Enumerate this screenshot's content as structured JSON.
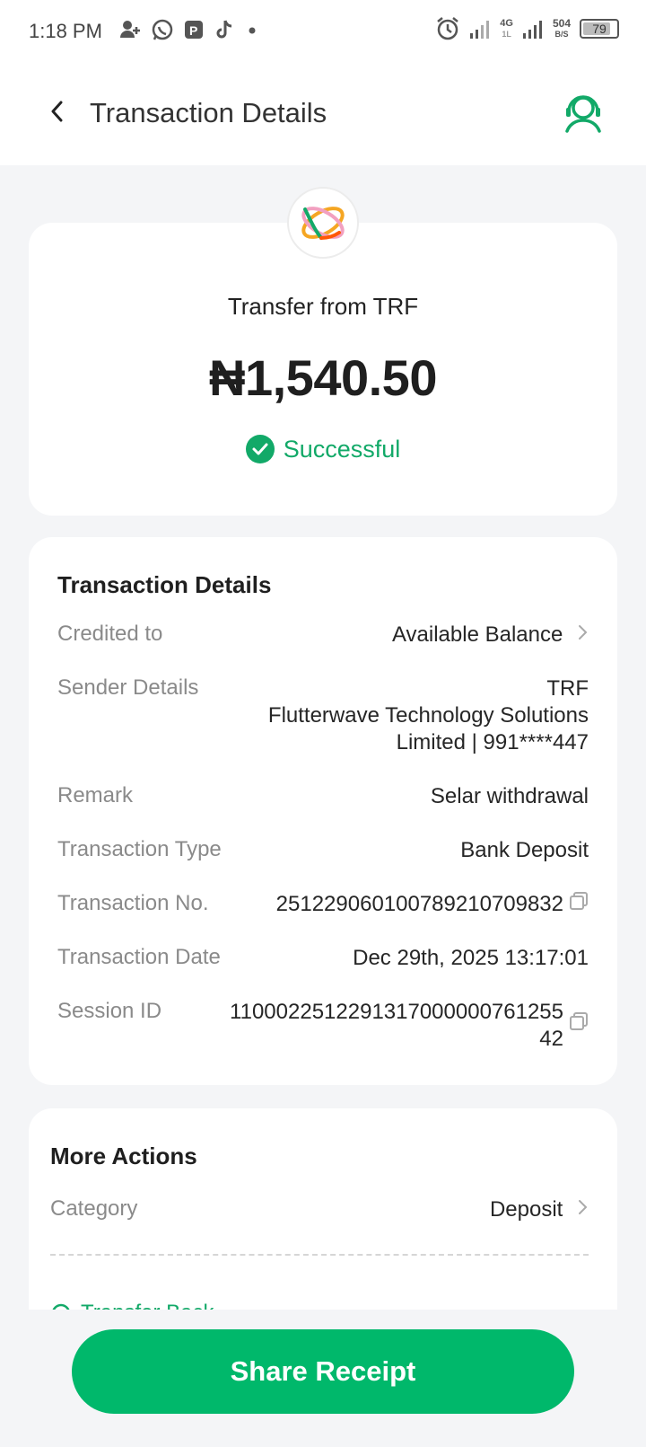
{
  "status_bar": {
    "time": "1:18 PM",
    "network_top": "4G",
    "network_bottom": "1L",
    "speed_value": "504",
    "speed_unit": "B/S",
    "battery": "79"
  },
  "header": {
    "title": "Transaction Details"
  },
  "summary": {
    "title": "Transfer from TRF",
    "amount": "₦1,540.50",
    "status": "Successful"
  },
  "details": {
    "section_title": "Transaction Details",
    "rows": [
      {
        "label": "Credited to",
        "value": "Available Balance"
      },
      {
        "label": "Sender Details",
        "value_line1": "TRF",
        "value_line2": "Flutterwave Technology Solutions",
        "value_line3": "Limited | 991****447"
      },
      {
        "label": "Remark",
        "value": "Selar withdrawal"
      },
      {
        "label": "Transaction Type",
        "value": "Bank Deposit"
      },
      {
        "label": "Transaction No.",
        "value": "251229060100789210709832"
      },
      {
        "label": "Transaction Date",
        "value": "Dec 29th, 2025 13:17:01"
      },
      {
        "label": "Session ID",
        "value_line1": "1100022512291317000000761255",
        "value_line2": "42"
      }
    ]
  },
  "more_actions": {
    "section_title": "More Actions",
    "category_label": "Category",
    "category_value": "Deposit",
    "transfer_back": "Transfer Back"
  },
  "share_button": "Share Receipt",
  "colors": {
    "accent": "#00b86b",
    "success": "#12a968",
    "background": "#f4f5f7"
  }
}
